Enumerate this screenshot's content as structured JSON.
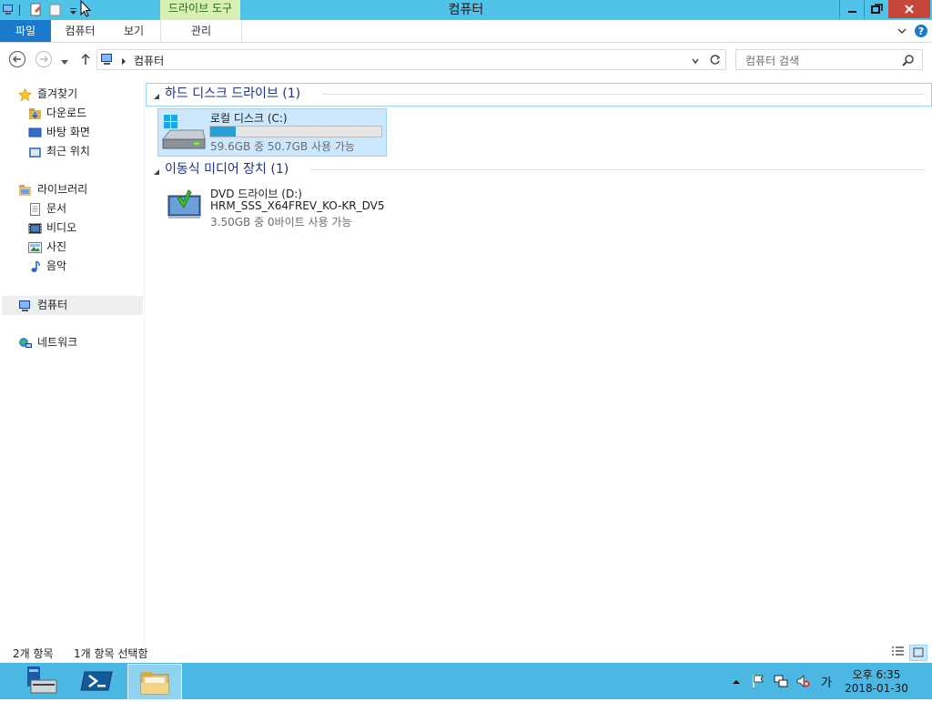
{
  "window": {
    "title": "컴퓨터",
    "contextual_tab": "드라이브 도구"
  },
  "ribbon": {
    "tabs": [
      {
        "label": "파일",
        "active": true
      },
      {
        "label": "컴퓨터"
      },
      {
        "label": "보기"
      },
      {
        "label": "관리"
      }
    ]
  },
  "address": {
    "path": "컴퓨터",
    "search_placeholder": "컴퓨터 검색"
  },
  "sidebar": {
    "favorites": {
      "label": "즐겨찾기",
      "items": [
        "다운로드",
        "바탕 화면",
        "최근 위치"
      ]
    },
    "libraries": {
      "label": "라이브러리",
      "items": [
        "문서",
        "비디오",
        "사진",
        "음악"
      ]
    },
    "computer": {
      "label": "컴퓨터"
    },
    "network": {
      "label": "네트워크"
    }
  },
  "content": {
    "groups": [
      {
        "title": "하드 디스크 드라이브 (1)",
        "drives": [
          {
            "name": "로컬 디스크 (C:)",
            "usage": "59.6GB 중 50.7GB 사용 가능",
            "used_fraction": 0.15
          }
        ]
      },
      {
        "title": "이동식 미디어 장치 (1)",
        "drives": [
          {
            "name": "DVD 드라이브 (D:)",
            "volume": "HRM_SSS_X64FREV_KO-KR_DV5",
            "usage": "3.50GB 중 0바이트 사용 가능"
          }
        ]
      }
    ]
  },
  "status": {
    "item_count": "2개 항목",
    "selection": "1개 항목 선택함"
  },
  "taskbar": {
    "ime": "가",
    "time": "오후 6:35",
    "date": "2018-01-30"
  },
  "colors": {
    "titlebar": "#4fc3e8",
    "file_tab": "#1979ca",
    "contextual_tab": "#d7efb3",
    "selection": "#cce8ff",
    "progress": "#26a0da",
    "taskbar": "#4bb8e4",
    "close_button": "#c7463a"
  }
}
